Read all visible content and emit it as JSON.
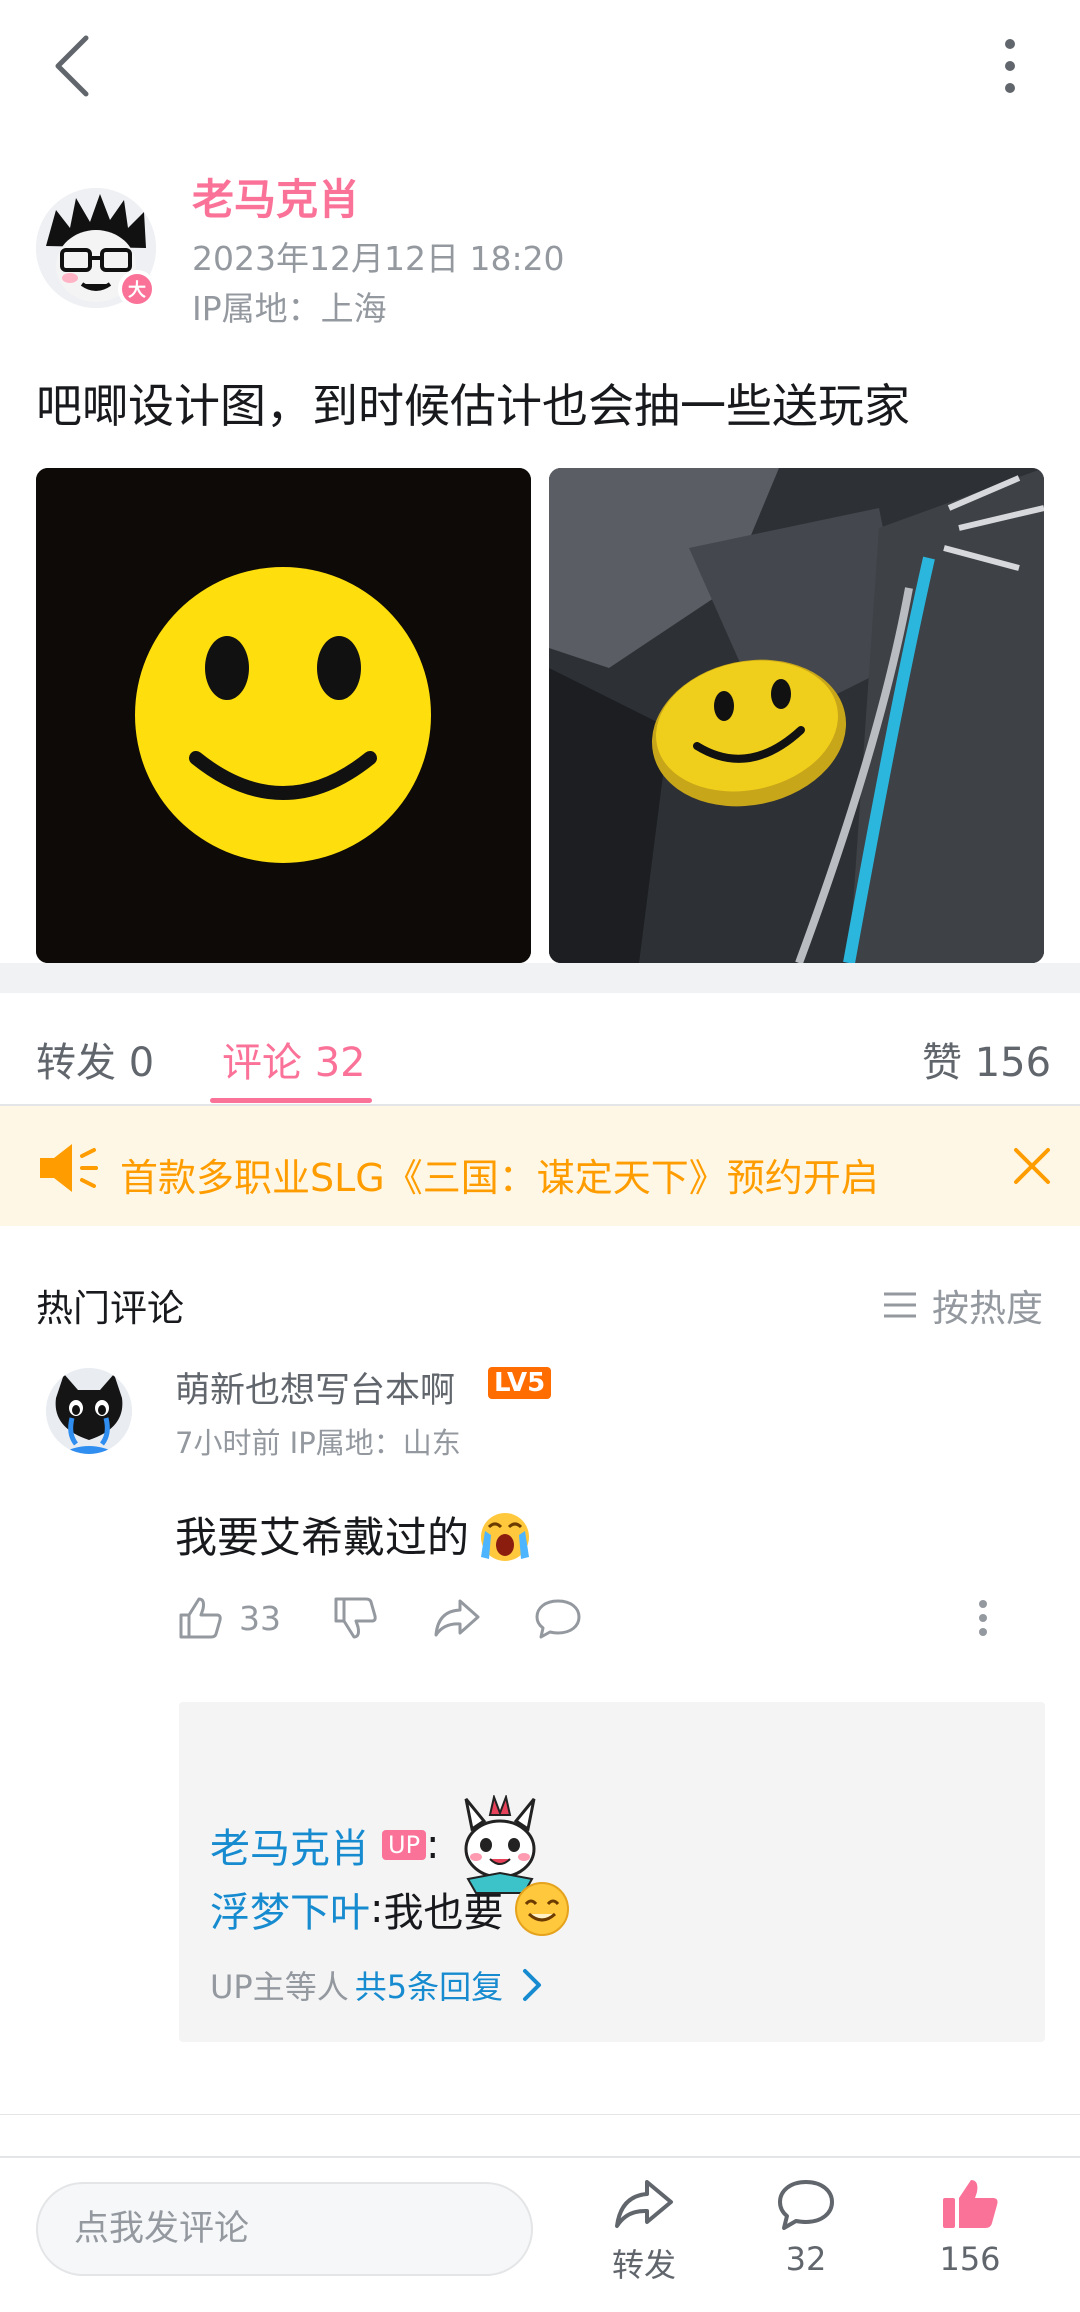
{
  "topbar": {
    "back_icon": "chevron-left-icon",
    "more_icon": "vertical-dots-icon"
  },
  "post": {
    "author": "老马克肖",
    "avatar_badge": "大",
    "time": "2023年12月12日 18:20",
    "ip": "IP属地：上海",
    "text": "吧唧设计图，到时候估计也会抽一些送玩家",
    "images": [
      "smiley-face-black-bg",
      "smiley-badge-on-jacket"
    ]
  },
  "tabs": {
    "forward": "转发 0",
    "comments": "评论 32",
    "likes": "赞 156"
  },
  "notice": {
    "text": "首款多职业SLG《三国：谋定天下》预约开启",
    "color": "#ff9d00"
  },
  "comments_section": {
    "title": "热门评论",
    "sort_label": "按热度"
  },
  "comment": {
    "user": "萌新也想写台本啊",
    "level": "LV5",
    "meta": "7小时前  IP属地：山东",
    "text": "我要艾希戴过的",
    "likes": "33"
  },
  "replies": [
    {
      "user": "老马克肖",
      "badge": "UP",
      "colon": ":",
      "text": ""
    },
    {
      "user": "浮梦下叶",
      "colon": ":",
      "text": " 我也要"
    }
  ],
  "replies_more": {
    "prefix": "UP主等人",
    "link": "共5条回复"
  },
  "bottombar": {
    "input_placeholder": "点我发评论",
    "forward_label": "转发",
    "comment_count": "32",
    "like_count": "156"
  },
  "colors": {
    "accent": "#fb7299",
    "link": "#178bcf",
    "muted": "#9499a0"
  }
}
